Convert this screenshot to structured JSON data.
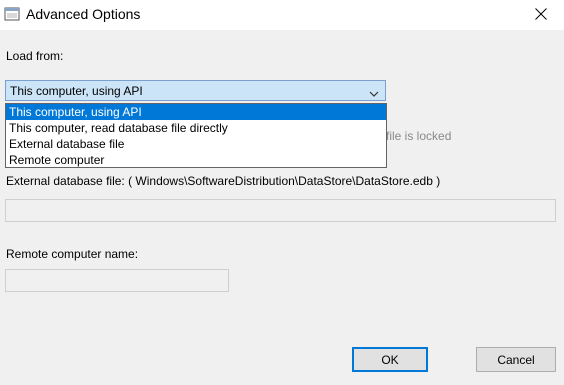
{
  "window": {
    "title": "Advanced Options",
    "icon": "window-app-icon",
    "close_icon": "close-icon"
  },
  "load_from": {
    "label": "Load from:",
    "selected": "This computer, using API",
    "options": [
      "This computer, using API",
      "This computer, read database file directly",
      "External database file",
      "Remote computer"
    ],
    "selected_index": 0
  },
  "locked_note": "file is locked",
  "external_db": {
    "label": "External database file: ( Windows\\SoftwareDistribution\\DataStore\\DataStore.edb )",
    "value": ""
  },
  "remote": {
    "label": "Remote computer name:",
    "value": ""
  },
  "buttons": {
    "ok": "OK",
    "cancel": "Cancel"
  },
  "colors": {
    "accent": "#0078d7",
    "combo_bg": "#cce4f7",
    "dialog_bg": "#f0f0f0"
  }
}
